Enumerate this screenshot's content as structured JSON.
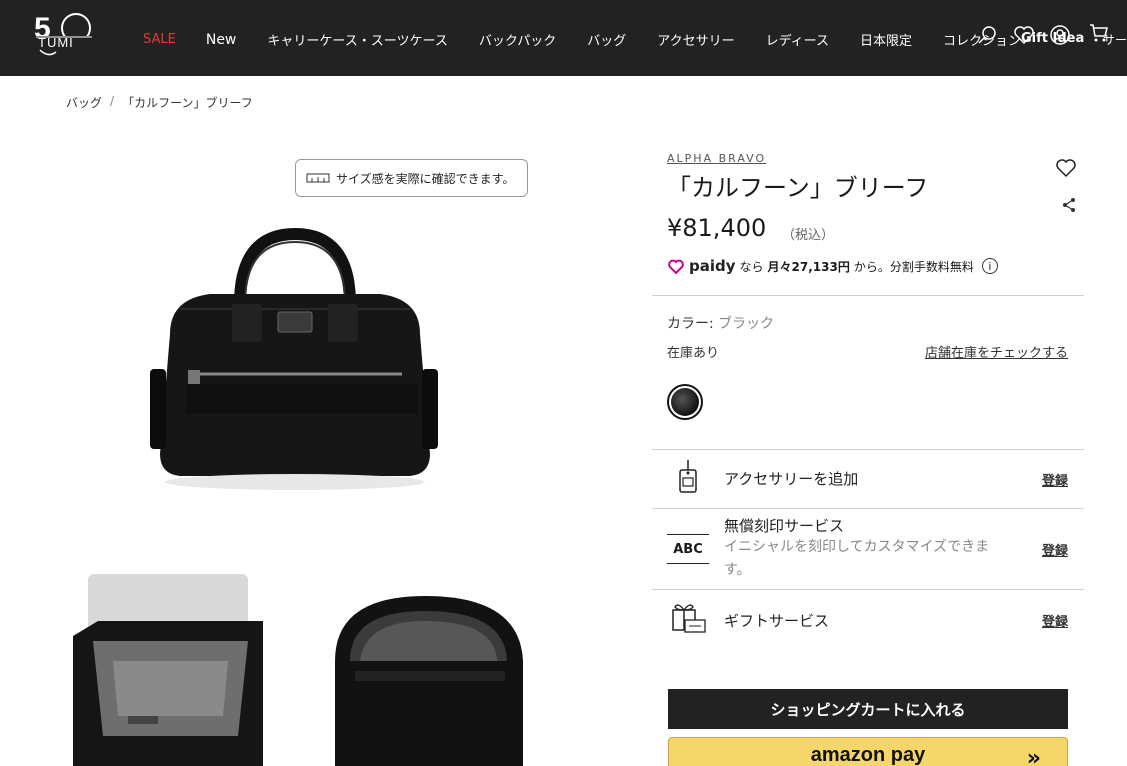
{
  "header": {
    "nav": [
      {
        "label": "SALE",
        "color": "#e03c31"
      },
      {
        "label": "New"
      },
      {
        "label": "キャリーケース・スーツケース"
      },
      {
        "label": "バックパック"
      },
      {
        "label": "バッグ"
      },
      {
        "label": "アクセサリー"
      },
      {
        "label": "レディース"
      },
      {
        "label": "日本限定"
      },
      {
        "label": "コレクション"
      }
    ],
    "gift_label": "Gift Idea",
    "cart_label": "サー",
    "logo_alt": "TUMI 50",
    "icons": [
      "search-icon",
      "wishlist-icon",
      "account-icon",
      "cart-icon"
    ]
  },
  "breadcrumb": {
    "items": [
      "バッグ",
      "「カルフーン」ブリーフ"
    ],
    "separator": "/"
  },
  "gallery": {
    "size_button": "サイズ感を実際に確認できます。"
  },
  "product": {
    "brand": "ALPHA BRAVO",
    "title": "「カルフーン」ブリーフ",
    "price": "¥81,400",
    "tax": "（税込）",
    "paidy": {
      "logo": "paidy",
      "pre": "なら",
      "monthly": "月々27,133円",
      "post": "から。分割手数料無料"
    },
    "color_label": "カラー:",
    "color_value": "ブラック",
    "stock": "在庫あり",
    "store_link": "店舗在庫をチェックする",
    "services": [
      {
        "label": "アクセサリーを追加",
        "link": "登録"
      },
      {
        "label": "無償刻印サービス",
        "desc": "イニシャルを刻印してカスタマイズできます。",
        "icon_text": "ABC",
        "link": "登録"
      },
      {
        "label": "ギフトサービス",
        "link": "登録"
      }
    ],
    "cart_button": "ショッピングカートに入れる",
    "amazon_button": "amazon pay",
    "amazon_chevron": "»"
  },
  "colors": {
    "header_bg": "#222222",
    "sale": "#e03c31",
    "amazon_bg": "#f5d66b"
  }
}
